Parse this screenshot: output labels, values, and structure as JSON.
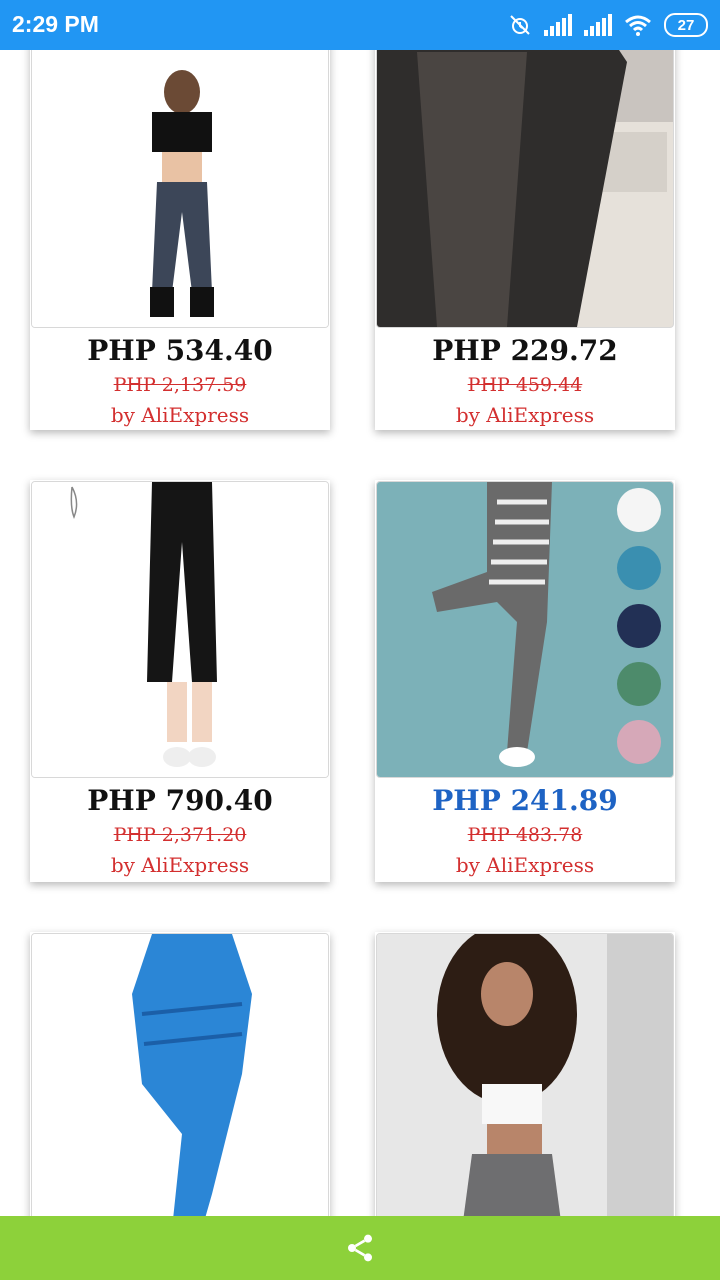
{
  "status_bar": {
    "time": "2:29 PM",
    "battery": "27"
  },
  "products": [
    {
      "price": "PHP 534.40",
      "old_price": "PHP 2,137.59",
      "seller": "by AliExpress"
    },
    {
      "price": "PHP 229.72",
      "old_price": "PHP 459.44",
      "seller": "by AliExpress"
    },
    {
      "price": "PHP 790.40",
      "old_price": "PHP 2,371.20",
      "seller": "by AliExpress"
    },
    {
      "price": "PHP 241.89",
      "old_price": "PHP 483.78",
      "seller": "by AliExpress"
    },
    {
      "price": "",
      "old_price": "",
      "seller": ""
    },
    {
      "price": "",
      "old_price": "",
      "seller": ""
    }
  ],
  "colors": {
    "status_bar": "#2196f3",
    "bottom_bar": "#8dd13a",
    "price_highlight": "#1e63c4",
    "discount_red": "#d32f2f"
  },
  "icons": {
    "share": "share-icon"
  }
}
